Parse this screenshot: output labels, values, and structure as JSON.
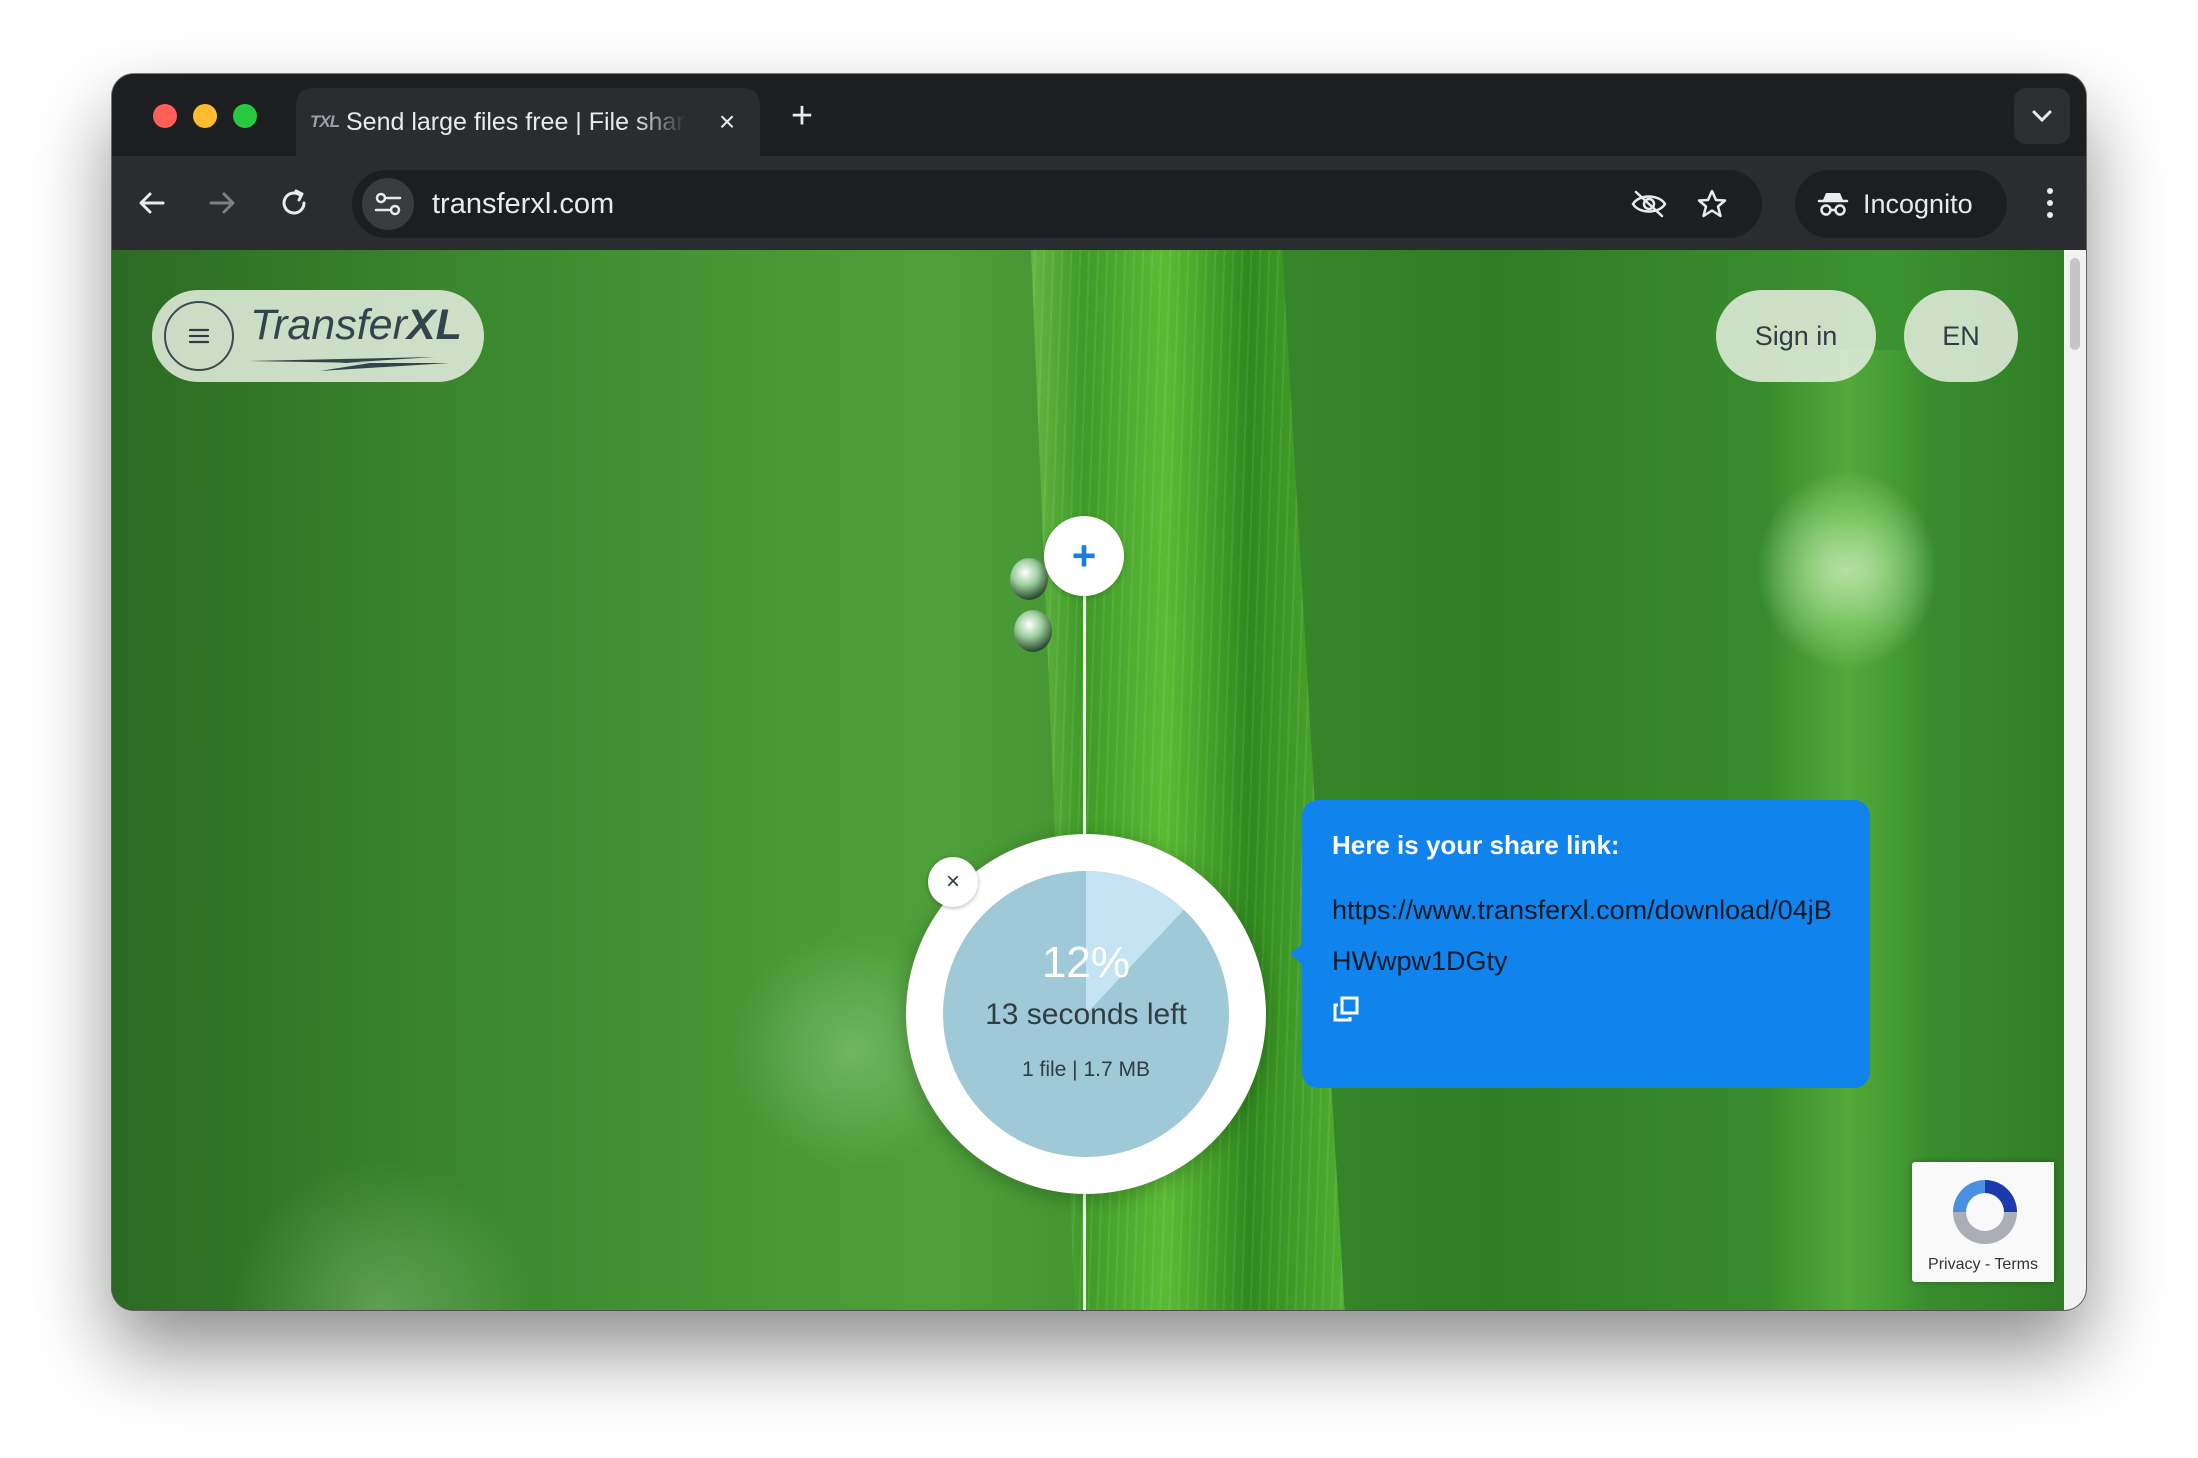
{
  "browser": {
    "tab": {
      "favicon_text": "TXL",
      "title": "Send large files free | File sharing",
      "close_glyph": "×"
    },
    "new_tab_glyph": "+",
    "url": "transferxl.com",
    "incognito_label": "Incognito"
  },
  "site": {
    "logo": {
      "light": "Transfer",
      "bold": "XL"
    },
    "sign_in_label": "Sign in",
    "language_label": "EN",
    "add_glyph": "+",
    "cancel_glyph": "×"
  },
  "upload": {
    "progress_percent": 12,
    "percent_label": "12%",
    "time_left": "13 seconds left",
    "file_info": "1 file | 1.7 MB"
  },
  "share": {
    "heading": "Here is your share link:",
    "link": "https://www.transferxl.com/download/04jBHWwpw1DGty"
  },
  "recaptcha": {
    "links": "Privacy - Terms"
  },
  "colors": {
    "share_card": "#1183ec",
    "progress_fill": "#9fc9d6",
    "progress_slice": "#c4e4f4",
    "add_icon": "#1a7be0"
  }
}
